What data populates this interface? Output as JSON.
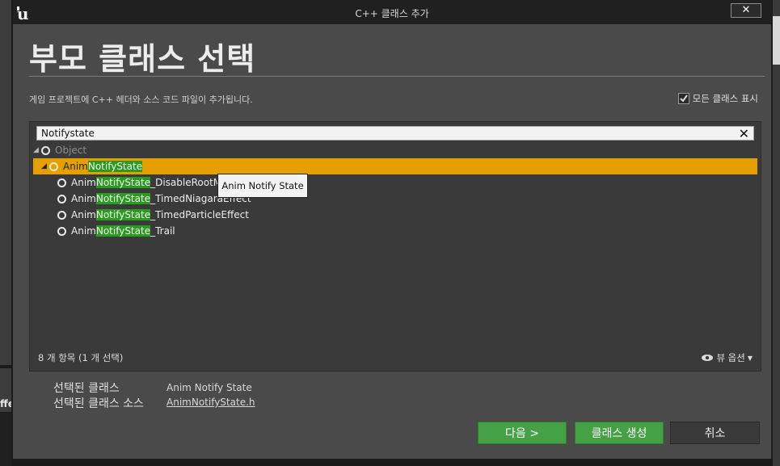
{
  "window": {
    "title": "C++ 클래스 추가",
    "close_glyph": "✕"
  },
  "page": {
    "heading": "부모 클래스 선택",
    "description": "게임 프로젝트에 C++ 헤더와 소스 코드 파일이 추가됩니다.",
    "show_all_label": "모든 클래스 표시",
    "show_all_checked": true
  },
  "search": {
    "value": "Notifystate",
    "clear_glyph": "✕"
  },
  "tree": {
    "root": {
      "label": "Object"
    },
    "selected": {
      "prefix": "Anim",
      "match": "NotifyState",
      "suffix": ""
    },
    "children": [
      {
        "prefix": "Anim",
        "match": "NotifyState",
        "suffix": "_DisableRootMo"
      },
      {
        "prefix": "Anim",
        "match": "NotifyState",
        "suffix": "_TimedNiagaraEffect"
      },
      {
        "prefix": "Anim",
        "match": "NotifyState",
        "suffix": "_TimedParticleEffect"
      },
      {
        "prefix": "Anim",
        "match": "NotifyState",
        "suffix": "_Trail"
      }
    ],
    "tooltip": "Anim Notify State"
  },
  "footer": {
    "count": "8 개 항목 (1 개 선택)",
    "view_options": "뷰 옵션"
  },
  "info": {
    "selected_class_label": "선택된 클래스",
    "selected_class_value": "Anim Notify State",
    "selected_source_label": "선택된 클래스 소스",
    "selected_source_value": "AnimNotifyState.h"
  },
  "buttons": {
    "next": "다음 >",
    "create": "클래스 생성",
    "cancel": "취소"
  },
  "background": {
    "left_text": "ffe"
  },
  "colors": {
    "selected_row": "#e5a000",
    "match_highlight": "#2b9b1f",
    "primary_button": "#45a145"
  }
}
